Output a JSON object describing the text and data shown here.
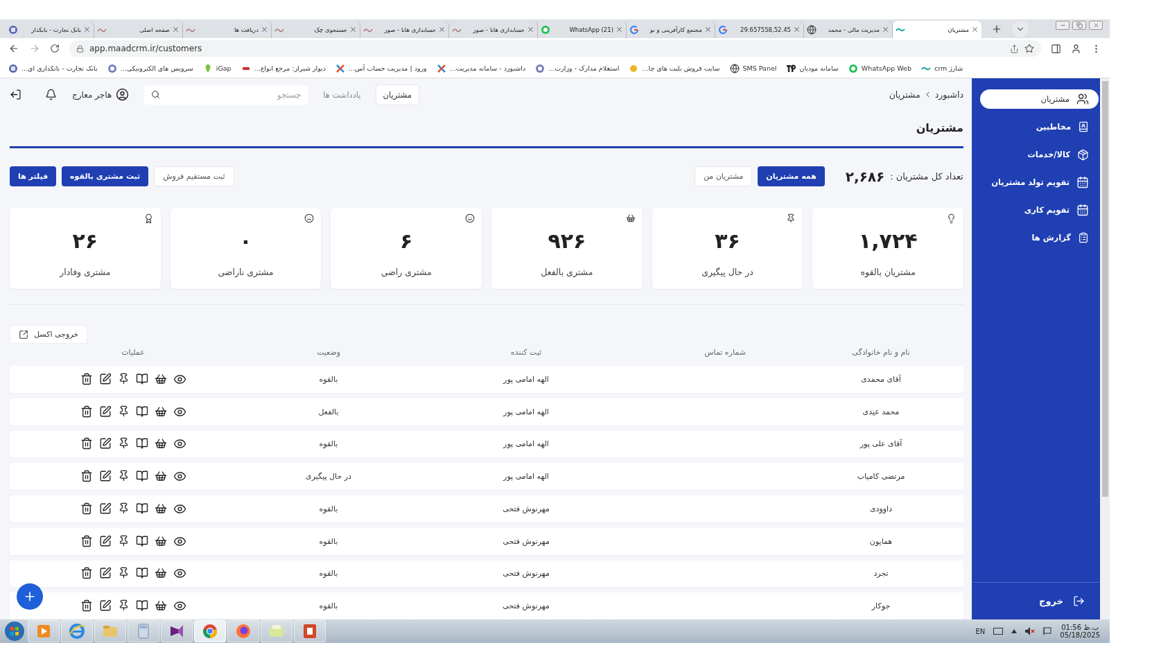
{
  "browser": {
    "tabs": [
      {
        "title": "مشتریان",
        "kind": "crm",
        "selected": true
      },
      {
        "title": "مدیریت مالی - محمد",
        "kind": "globe",
        "selected": false
      },
      {
        "title": "29.657558,52.45",
        "kind": "google",
        "selected": false
      },
      {
        "title": "مجتمع کارآفرینی و نو",
        "kind": "google",
        "selected": false
      },
      {
        "title": "(21) WhatsApp",
        "kind": "whatsapp",
        "selected": false
      },
      {
        "title": "حسابداری هانا - صور",
        "kind": "site",
        "selected": false
      },
      {
        "title": "حسابداری هانا - صور",
        "kind": "site",
        "selected": false
      },
      {
        "title": "جستجوی چک",
        "kind": "site",
        "selected": false
      },
      {
        "title": "دریافت ها",
        "kind": "site",
        "selected": false
      },
      {
        "title": "صفحه اصلی",
        "kind": "site",
        "selected": false
      },
      {
        "title": "بانک تجارت - بانکدار",
        "kind": "bank",
        "selected": false
      }
    ],
    "address": "app.maadcrm.ir/customers",
    "bookmarks": [
      {
        "title": "شارژ crm",
        "kind": "crm"
      },
      {
        "title": "WhatsApp Web",
        "kind": "whatsapp"
      },
      {
        "title": "سامانه مودیان",
        "kind": "tp"
      },
      {
        "title": "SMS Panel",
        "kind": "globe"
      },
      {
        "title": "سایت فروش بلیت های چا...",
        "kind": "ticket"
      },
      {
        "title": "استعلام مدارک - وزارت...",
        "kind": "emblem"
      },
      {
        "title": "داشبورد - سامانه مدیریت...",
        "kind": "cross"
      },
      {
        "title": "ورود | مدیریت حساب آس...",
        "kind": "cross"
      },
      {
        "title": "دیوار شیراز: مرجع انواع...",
        "kind": "divar"
      },
      {
        "title": "iGap",
        "kind": "igap"
      },
      {
        "title": "سرویس های الکترونیکی...",
        "kind": "emblem"
      },
      {
        "title": "بانک تجارت - بانکداری ای...",
        "kind": "bank"
      }
    ]
  },
  "app": {
    "breadcrumb": [
      "داشبورد",
      "مشتریان"
    ],
    "top_tabs": [
      {
        "label": "مشتریان",
        "selected": true
      },
      {
        "label": "یادداشت ها",
        "selected": false
      }
    ],
    "search": {
      "placeholder": "جستجو"
    },
    "user": "هاجر معارج",
    "page_title": "مشتریان",
    "total_label": "تعداد کل مشتریان :",
    "total": "۲,۶۸۶",
    "filters": [
      {
        "label": "همه مشتریان",
        "selected": true
      },
      {
        "label": "مشتریان من",
        "selected": false
      }
    ],
    "actions": [
      {
        "label": "ثبت مستقیم فروش",
        "kind": "outline"
      },
      {
        "label": "ثبت مشتری بالقوه",
        "kind": "primary"
      },
      {
        "label": "فیلتر ها",
        "kind": "primary"
      }
    ],
    "stats": [
      {
        "value": "۱,۷۲۴",
        "label": "مشتریان بالقوه",
        "kind": "bulb"
      },
      {
        "value": "۳۶",
        "label": "در حال پیگیری",
        "kind": "pin"
      },
      {
        "value": "۹۲۶",
        "label": "مشتری بالفعل",
        "kind": "basket"
      },
      {
        "value": "۶",
        "label": "مشتری راضی",
        "kind": "smile"
      },
      {
        "value": "۰",
        "label": "مشتری ناراضی",
        "kind": "frown"
      },
      {
        "value": "۲۶",
        "label": "مشتری وفادار",
        "kind": "award"
      }
    ],
    "export": "خروجی اکسل",
    "table": {
      "columns": [
        "نام و نام خانوادگی",
        "شماره تماس",
        "ثبت کننده",
        "وضعیت",
        "عملیات"
      ],
      "rows": [
        {
          "name": "آقای محمدی",
          "registrar": "الهه امامی پور",
          "status": "بالقوه"
        },
        {
          "name": "محمد عیدی",
          "registrar": "الهه امامی پور",
          "status": "بالفعل"
        },
        {
          "name": "آقای علی پور",
          "registrar": "الهه امامی پور",
          "status": "بالقوه"
        },
        {
          "name": "مرتضی کامیاب",
          "registrar": "الهه امامی پور",
          "status": "در حال پیگیری"
        },
        {
          "name": "داوودی",
          "registrar": "مهرنوش فتحی",
          "status": "بالقوه"
        },
        {
          "name": "همایون",
          "registrar": "مهرنوش فتحی",
          "status": "بالقوه"
        },
        {
          "name": "تجرد",
          "registrar": "مهرنوش فتحی",
          "status": "بالقوه"
        },
        {
          "name": "جوکار",
          "registrar": "مهرنوش فتحی",
          "status": "بالقوه"
        }
      ]
    }
  },
  "sidebar": {
    "items": [
      {
        "label": "مشتریان",
        "kind": "users",
        "selected": true
      },
      {
        "label": "مخاطبین",
        "kind": "contacts",
        "selected": false
      },
      {
        "label": "کالا/خدمات",
        "kind": "box",
        "selected": false
      },
      {
        "label": "تقویم تولد مشتریان",
        "kind": "calendar",
        "selected": false
      },
      {
        "label": "تقویم کاری",
        "kind": "calendar",
        "selected": false
      },
      {
        "label": "گزارش ها",
        "kind": "report",
        "selected": false
      }
    ],
    "logout": "خروج"
  },
  "taskbar": {
    "apps": [
      {
        "kind": "media",
        "selected": false
      },
      {
        "kind": "ie",
        "selected": false
      },
      {
        "kind": "explorer",
        "selected": false
      },
      {
        "kind": "calculator",
        "selected": false
      },
      {
        "kind": "vs",
        "selected": false
      },
      {
        "kind": "chrome",
        "selected": true
      },
      {
        "kind": "firefox",
        "selected": false
      },
      {
        "kind": "folder",
        "selected": false
      },
      {
        "kind": "powerpoint",
        "selected": false
      }
    ],
    "language": "EN",
    "time": "01:56 ب.ظ",
    "date": "05/18/2025"
  }
}
